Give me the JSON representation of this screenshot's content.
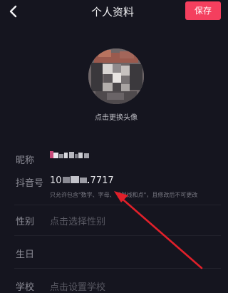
{
  "header": {
    "title": "个人资料",
    "save_label": "保存",
    "back_icon": "back-chevron-icon",
    "accent": "#f43f5e"
  },
  "avatar": {
    "caption": "点击更换头像"
  },
  "fields": {
    "nickname": {
      "label": "昵称"
    },
    "douyin_id": {
      "label": "抖音号",
      "value_prefix": "10",
      "value_suffix": "7717",
      "hint": "只允许包含\"数字、字母、下划线和点\"，且修改后不可更改"
    },
    "gender": {
      "label": "性别",
      "placeholder": "点击选择性别"
    },
    "birthday": {
      "label": "生日"
    },
    "school": {
      "label": "学校",
      "placeholder": "点击设置学校"
    }
  }
}
